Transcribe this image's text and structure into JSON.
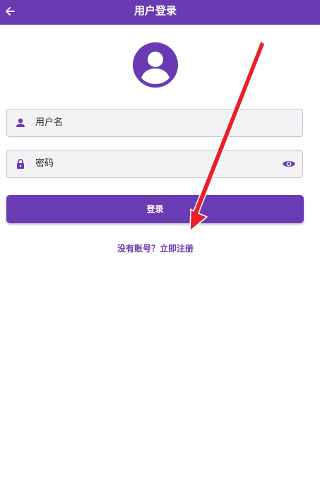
{
  "app_bar": {
    "title": "用户登录",
    "back_icon": "arrow-left-icon",
    "color": "#6a3ab4"
  },
  "avatar": {
    "icon": "account-circle-icon"
  },
  "username_field": {
    "icon": "person-icon",
    "placeholder": "用户名"
  },
  "password_field": {
    "icon": "lock-icon",
    "placeholder": "密码",
    "toggle_icon": "eye-icon"
  },
  "login_button": {
    "label": "登录"
  },
  "register_link": {
    "label": "没有账号？立即注册"
  },
  "annotation": {
    "type": "red-arrow",
    "color": "#e8202a"
  }
}
